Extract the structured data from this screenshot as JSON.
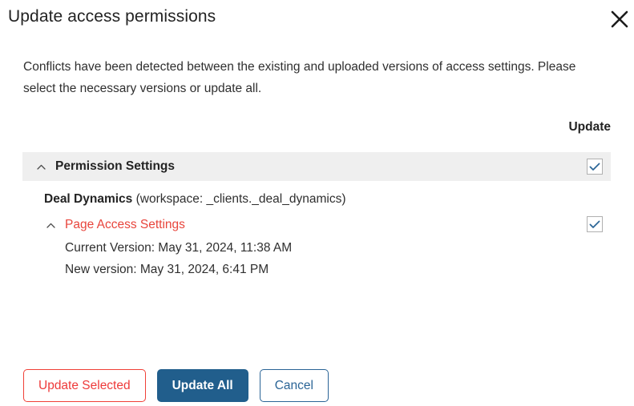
{
  "dialog": {
    "title": "Update access permissions",
    "close_icon": "close-icon",
    "description": "Conflicts have been detected between the existing and uploaded versions of access settings. Please select the necessary versions or update all."
  },
  "table": {
    "column_header": "Update",
    "group": {
      "caret_icon": "chevron-up-icon",
      "label": "Permission Settings",
      "checkbox_checked": true
    },
    "workspace": {
      "name": "Deal Dynamics",
      "details": " (workspace: _clients._deal_dynamics)"
    },
    "item": {
      "caret_icon": "chevron-up-icon",
      "label": "Page Access Settings",
      "checkbox_checked": true,
      "current_version": "Current Version: May 31, 2024, 11:38 AM",
      "new_version": "New version: May 31, 2024, 6:41 PM"
    }
  },
  "footer": {
    "update_selected_label": "Update Selected",
    "update_all_label": "Update All",
    "cancel_label": "Cancel"
  },
  "colors": {
    "accent_red": "#ee3a3a",
    "accent_blue": "#215e8c",
    "link_red": "#e8453c",
    "band_gray": "#efefef",
    "check_blue": "#2a6496"
  }
}
